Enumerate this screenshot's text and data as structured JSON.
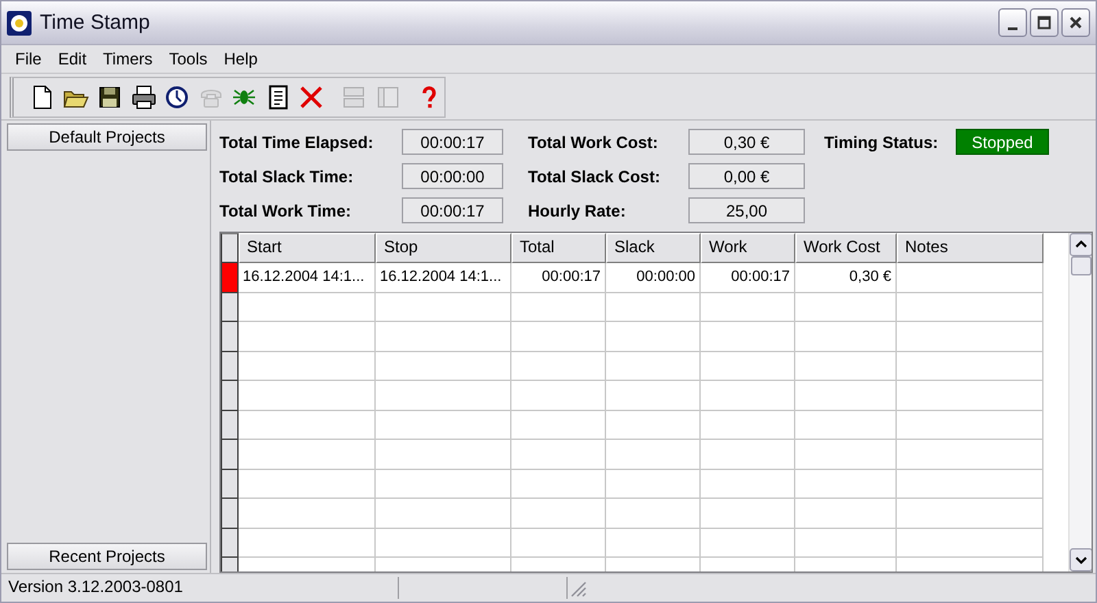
{
  "window": {
    "title": "Time Stamp"
  },
  "menu": [
    "File",
    "Edit",
    "Timers",
    "Tools",
    "Help"
  ],
  "toolbar": [
    {
      "kind": "new",
      "disabled": false
    },
    {
      "kind": "open",
      "disabled": false
    },
    {
      "kind": "save",
      "disabled": false
    },
    {
      "kind": "print",
      "disabled": false
    },
    {
      "kind": "clock",
      "disabled": false
    },
    {
      "kind": "phone",
      "disabled": true
    },
    {
      "kind": "bug",
      "disabled": false
    },
    {
      "kind": "report",
      "disabled": false
    },
    {
      "kind": "delete",
      "disabled": false
    },
    {
      "kind": "rows",
      "disabled": true
    },
    {
      "kind": "columns",
      "disabled": true
    },
    {
      "kind": "help",
      "disabled": false
    }
  ],
  "sidebar": {
    "top_button": "Default Projects",
    "bottom_button": "Recent Projects"
  },
  "summary": [
    {
      "label": "Total Time Elapsed:",
      "value": "00:00:17"
    },
    {
      "label": "Total Work Cost:",
      "value": "0,30 €"
    },
    {
      "label": "Total Slack Time:",
      "value": "00:00:00"
    },
    {
      "label": "Total Slack Cost:",
      "value": "0,00 €"
    },
    {
      "label": "Total Work Time:",
      "value": "00:00:17"
    },
    {
      "label": "Hourly Rate:",
      "value": "25,00"
    }
  ],
  "timing_status": {
    "label": "Timing Status:",
    "value": "Stopped"
  },
  "table": {
    "columns": [
      "Start",
      "Stop",
      "Total",
      "Slack",
      "Work",
      "Work Cost",
      "Notes"
    ],
    "rows": [
      {
        "current": true,
        "cells": [
          "16.12.2004 14:1...",
          "16.12.2004 14:1...",
          "00:00:17",
          "00:00:00",
          "00:00:17",
          "0,30 €",
          ""
        ]
      }
    ]
  },
  "status_bar": {
    "version": "Version 3.12.2003-0801"
  }
}
